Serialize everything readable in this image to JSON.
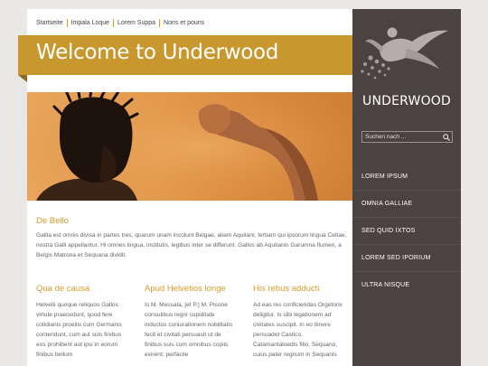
{
  "breadcrumb": [
    "Startseite",
    "Impala Loque",
    "Lorem Suppa",
    "Noris et pouns"
  ],
  "banner": {
    "title": "Welcome to Underwood"
  },
  "intro": {
    "heading": "De Bello",
    "text": "Gallia est omnis divisa in partes tres, quarum unam incolunt Belgae, aliam Aquitani, tertiam qui ipsorum lingua Celtae, nostra Galli appellantur. Hi omnes lingua, institutis, legibus inter se differunt. Gallos ab Aquitanis Garumna flumen, a Belgis Matrona et Sequana dividit."
  },
  "columns": [
    {
      "heading": "Qua de causa",
      "text": "Helvetii quoque reliquos Gallos virtute praecedunt, quod fere cotidianis proeliis cum Germanis contendunt, cum aut suis finibus eos prohibent aut ipsi in eorum finibus bellum"
    },
    {
      "heading": "Apud Helvetios longe",
      "text": "Is M. Messala, [et P.] M. Pisone consulibus regni cupiditate inductus coniurationem nobilitatis fecit et civitati persuasit ut de finibus suis cum omnibus copiis exirent: perfacile"
    },
    {
      "heading": "His rebus adducti",
      "text": "Ad eas res conficiendas Orgetorix deligitur. Is sibi legationem ad civitates suscipit. In eo itinere persuadet Castico, Catamantaloedis filio, Sequano, cuius pater regnum in Sequanis"
    }
  ],
  "sidebar": {
    "brand": "UNDERWOOD",
    "search_placeholder": "Suchen nach ...",
    "menu": [
      "LOREM IPSUM",
      "OMNIA GALLIAE",
      "SED QUID IXTOS",
      "LOREM SED IPORIUM",
      "ULTRA NISQUE"
    ]
  },
  "colors": {
    "accent": "#c8972e",
    "heading": "#d99a2b",
    "sidebar": "#4a4341"
  }
}
